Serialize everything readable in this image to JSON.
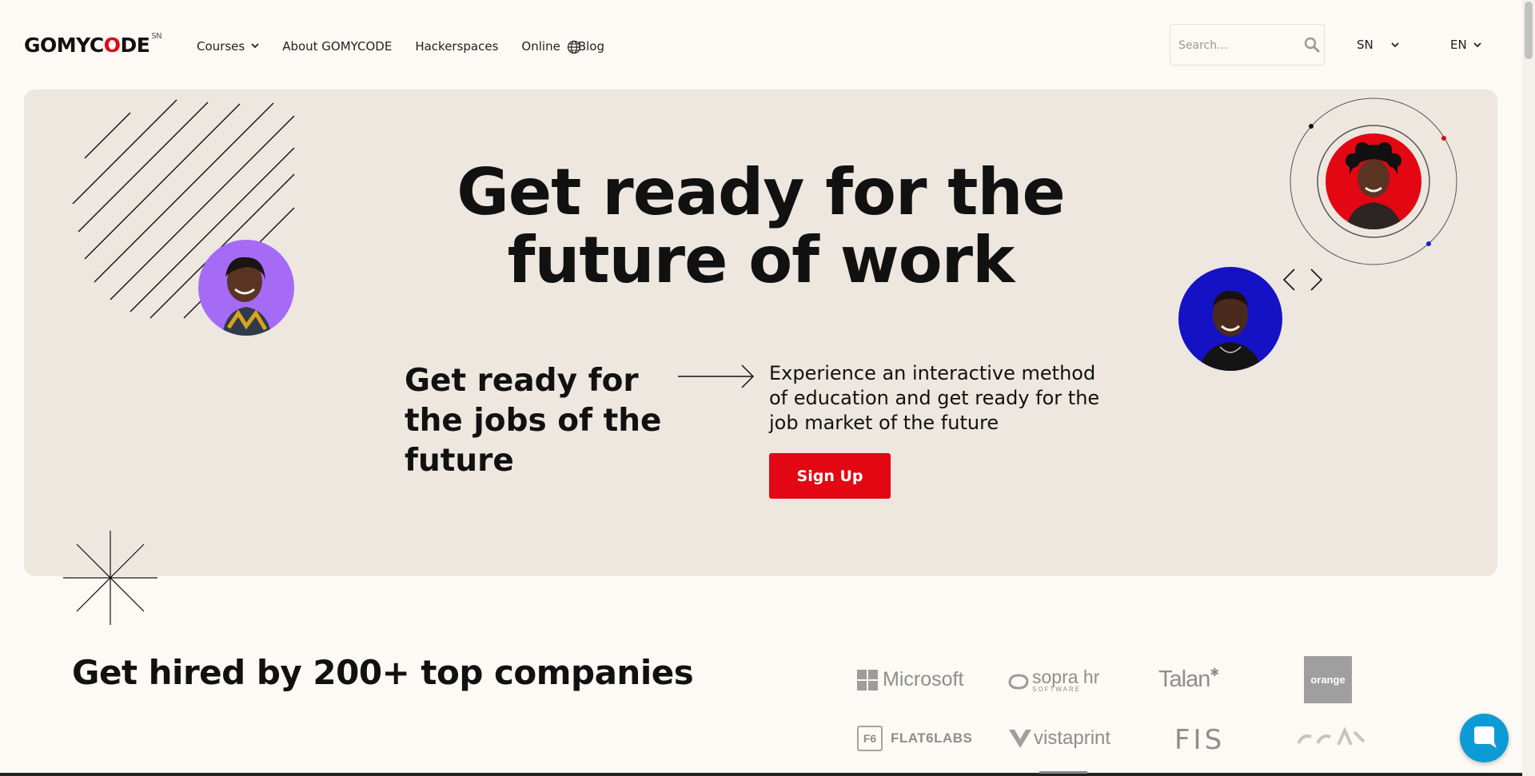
{
  "brand": {
    "name_prefix": "GOMYC",
    "name_highlight": "O",
    "name_suffix": "DE",
    "region_badge": "SN"
  },
  "nav": {
    "courses": "Courses",
    "about": "About GOMYCODE",
    "hackerspaces": "Hackerspaces",
    "online": "Online",
    "blog": "Blog"
  },
  "search": {
    "placeholder": "Search..."
  },
  "country_select": {
    "value": "SN"
  },
  "language_select": {
    "value": "EN"
  },
  "hero": {
    "title_line1": "Get ready for the",
    "title_line2": "future of work",
    "subtitle": "Get ready for the jobs of the future",
    "description": "Experience an interactive method of education and get ready for the job market of the future",
    "cta_label": "Sign Up"
  },
  "companies": {
    "title": "Get hired by 200+ top companies",
    "logos": [
      "Microsoft",
      "sopra hr",
      "SOFTWARE",
      "Talan",
      "orange",
      "FLAT6LABS",
      "vistaprint",
      "FIS"
    ]
  },
  "colors": {
    "accent": "#e30613",
    "hero_bg": "#ede7df",
    "page_bg": "#fdf9f4",
    "chat": "#0d9bd5"
  },
  "icons": [
    "chevron-down-icon",
    "globe-icon",
    "search-icon",
    "arrow-right-icon",
    "chevron-left-icon",
    "chevron-right-icon",
    "chat-icon"
  ]
}
